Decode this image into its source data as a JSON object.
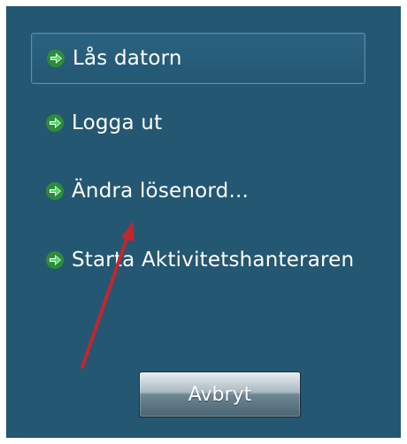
{
  "menu": {
    "items": [
      {
        "label": "Lås datorn",
        "icon": "green-arrow-icon",
        "selected": true
      },
      {
        "label": "Logga ut",
        "icon": "green-arrow-icon",
        "selected": false
      },
      {
        "label": "Ändra lösenord...",
        "icon": "green-arrow-icon",
        "selected": false
      },
      {
        "label": "Starta Aktivitetshanteraren",
        "icon": "green-arrow-icon",
        "selected": false
      }
    ]
  },
  "footer": {
    "cancel_label": "Avbryt"
  },
  "colors": {
    "background": "#245772",
    "arrow_icon": "#3cb371",
    "annotation": "#c0272d"
  }
}
